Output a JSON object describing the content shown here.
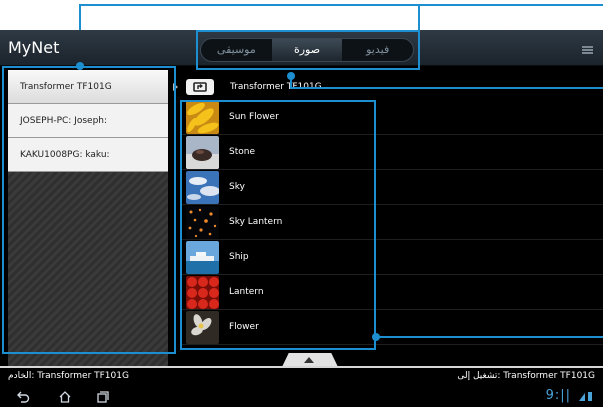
{
  "header": {
    "title": "MyNet",
    "tabs": [
      {
        "label": "موسيقى",
        "active": false
      },
      {
        "label": "صورة",
        "active": true
      },
      {
        "label": "فيديو",
        "active": false
      }
    ]
  },
  "sidebar": {
    "servers": [
      {
        "label": "Transformer TF101G",
        "selected": true
      },
      {
        "label": "JOSEPH-PC: Joseph:",
        "selected": false
      },
      {
        "label": "KAKU1008PG: kaku:",
        "selected": false
      }
    ]
  },
  "breadcrumb": {
    "path": "Transformer TF101G"
  },
  "files": [
    {
      "name": "Sun Flower",
      "thumb": "sun-flower-thumbnail"
    },
    {
      "name": "Stone",
      "thumb": "stone-thumbnail"
    },
    {
      "name": "Sky",
      "thumb": "sky-thumbnail"
    },
    {
      "name": "Sky Lantern",
      "thumb": "sky-lantern-thumbnail"
    },
    {
      "name": "Ship",
      "thumb": "ship-thumbnail"
    },
    {
      "name": "Lantern",
      "thumb": "lantern-thumbnail"
    },
    {
      "name": "Flower",
      "thumb": "flower-thumbnail"
    }
  ],
  "status": {
    "server_text": "الخادم: Transformer TF101G",
    "play_to_text": "تشغيل إلى: Transformer TF101G",
    "clock": "9:||"
  },
  "colors": {
    "callout": "#1d8fd0",
    "clock": "#4aa3d9"
  }
}
